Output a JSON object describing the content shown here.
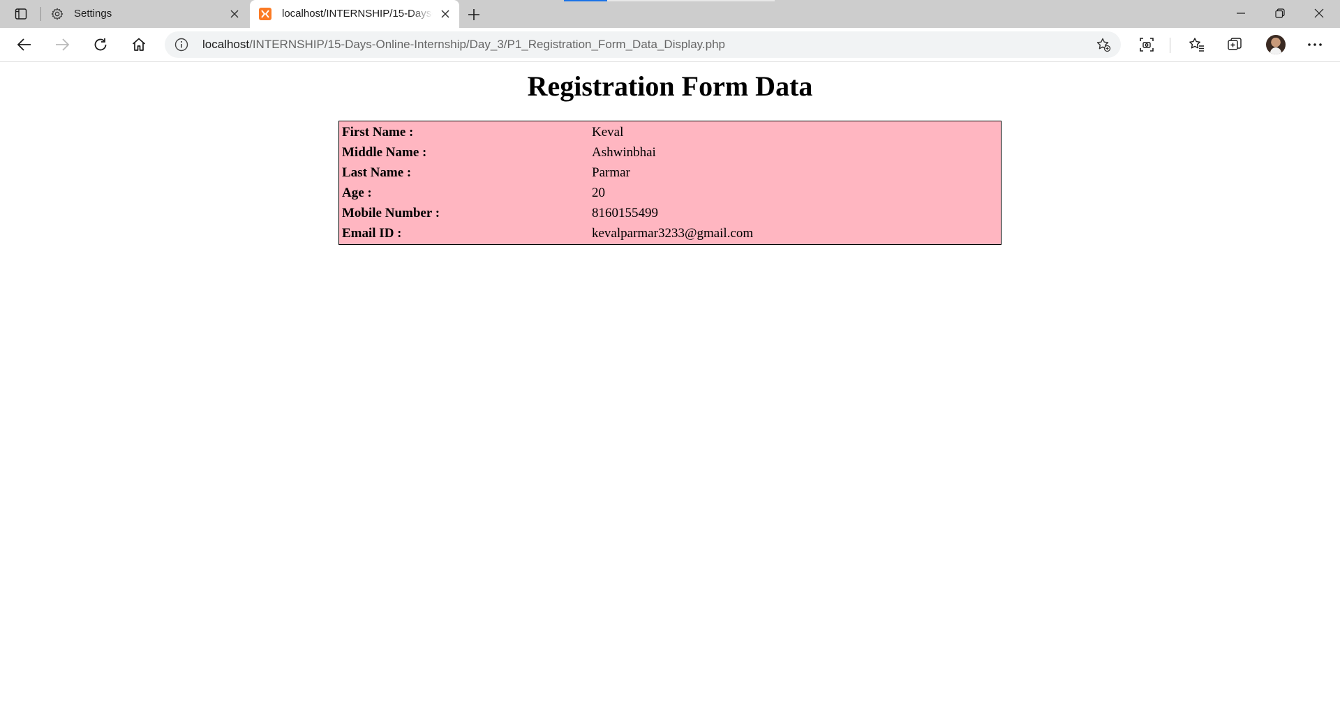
{
  "browser": {
    "tabs": [
      {
        "title": "Settings",
        "icon": "gear-icon",
        "active": false
      },
      {
        "title": "localhost/INTERNSHIP/15-Days-Online-Internship/Day_3/P1_Registration_Form_Data_Display.php",
        "icon": "xampp-icon",
        "active": true
      }
    ],
    "address": {
      "host": "localhost",
      "path": "/INTERNSHIP/15-Days-Online-Internship/Day_3/P1_Registration_Form_Data_Display.php"
    },
    "accent_color": "#1a73e8"
  },
  "page": {
    "title": "Registration Form Data",
    "table_background": "#ffb6c1",
    "rows": [
      {
        "label": "First Name :",
        "value": "Keval"
      },
      {
        "label": "Middle Name :",
        "value": "Ashwinbhai"
      },
      {
        "label": "Last Name :",
        "value": "Parmar"
      },
      {
        "label": "Age :",
        "value": "20"
      },
      {
        "label": "Mobile Number :",
        "value": "8160155499"
      },
      {
        "label": "Email ID :",
        "value": "kevalparmar3233@gmail.com"
      }
    ]
  }
}
